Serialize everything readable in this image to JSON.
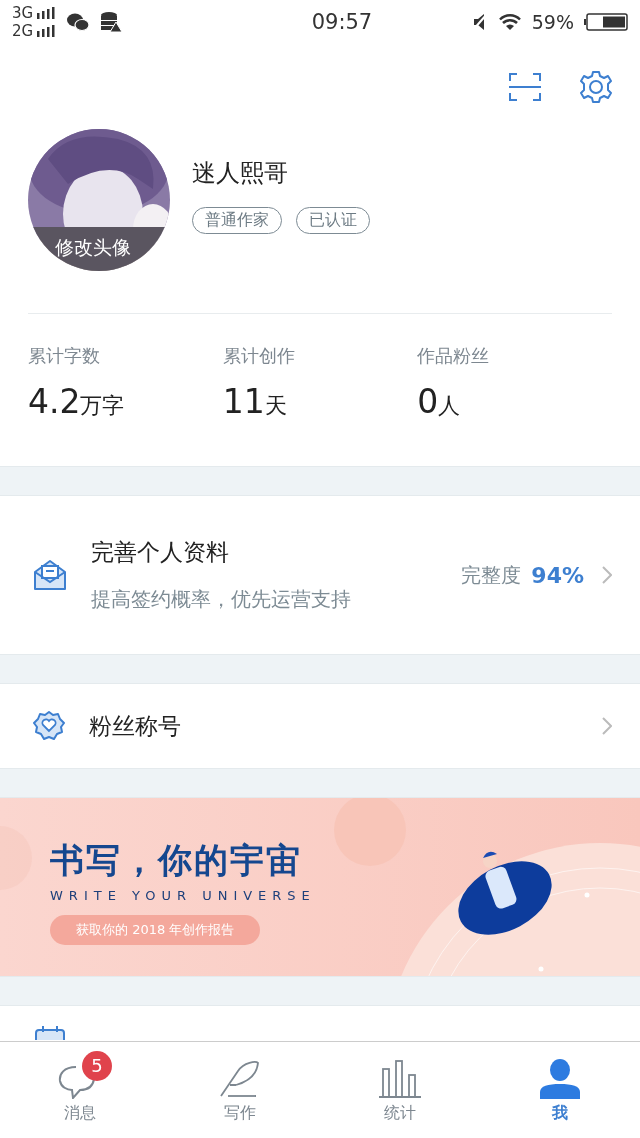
{
  "status_bar": {
    "network_1": "3G",
    "network_2": "2G",
    "time": "09:57",
    "battery": "59%"
  },
  "profile": {
    "avatar_caption": "修改头像",
    "name": "迷人熙哥",
    "tags": [
      "普通作家",
      "已认证"
    ]
  },
  "stats": [
    {
      "label": "累计字数",
      "value": "4.2",
      "unit": "万字"
    },
    {
      "label": "累计创作",
      "value": "11",
      "unit": "天"
    },
    {
      "label": "作品粉丝",
      "value": "0",
      "unit": "人"
    }
  ],
  "profile_card": {
    "title": "完善个人资料",
    "subtitle": "提高签约概率，优先运营支持",
    "completeness_label": "完整度",
    "completeness_value": "94%"
  },
  "fan_title": {
    "title": "粉丝称号"
  },
  "banner": {
    "headline": "书写，你的宇宙",
    "tagline": "WRITE YOUR UNIVERSE",
    "button": "获取你的 2018 年创作报告"
  },
  "tabs": [
    {
      "kind": "messages",
      "label": "消息",
      "badge": "5",
      "selected": false
    },
    {
      "kind": "write",
      "label": "写作",
      "selected": false
    },
    {
      "kind": "stats",
      "label": "统计",
      "selected": false
    },
    {
      "kind": "me",
      "label": "我",
      "selected": true
    }
  ]
}
